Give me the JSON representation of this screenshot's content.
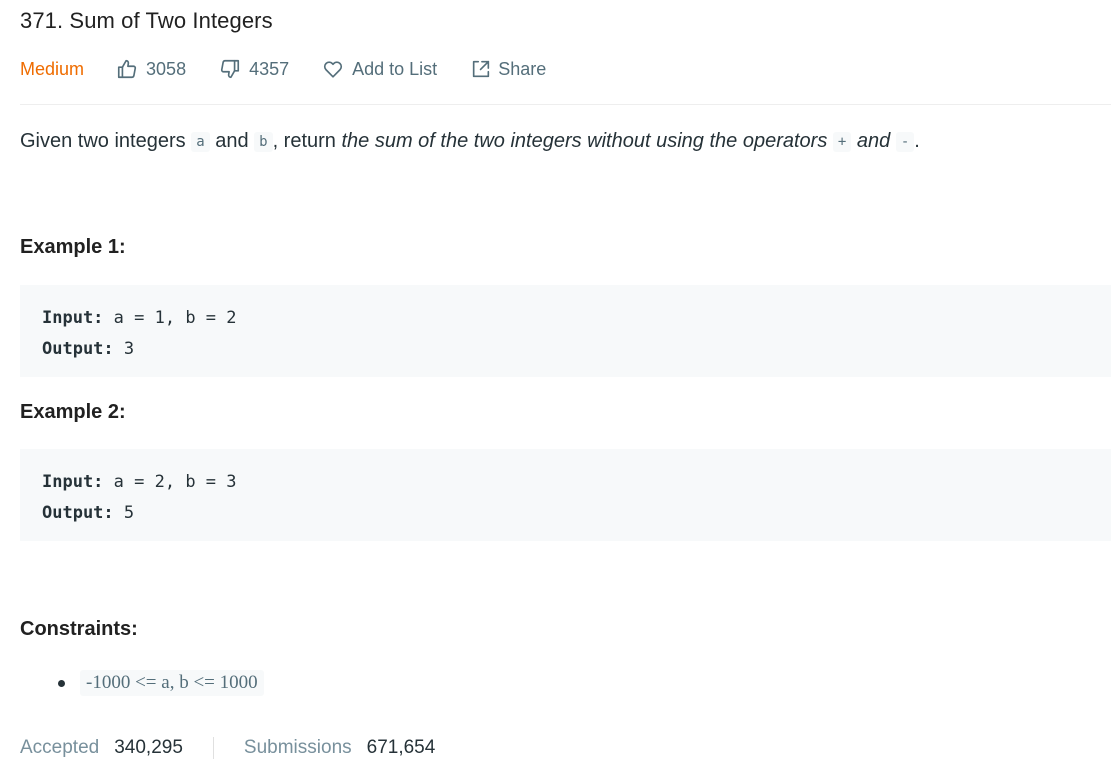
{
  "problem": {
    "title": "371. Sum of Two Integers",
    "difficulty": "Medium",
    "likes": "3058",
    "dislikes": "4357",
    "add_to_list": "Add to List",
    "share": "Share"
  },
  "description": {
    "part1": "Given two integers ",
    "code_a": "a",
    "part2": " and ",
    "code_b": "b",
    "part3": ", return ",
    "italic1": "the sum of the two integers without using the operators",
    "part4": " ",
    "code_plus": "+",
    "part5": " ",
    "italic2": "and",
    "part6": " ",
    "code_minus": "-",
    "part7": "."
  },
  "examples": [
    {
      "heading": "Example 1:",
      "input_label": "Input:",
      "input_value": "a = 1, b = 2",
      "output_label": "Output:",
      "output_value": "3"
    },
    {
      "heading": "Example 2:",
      "input_label": "Input:",
      "input_value": "a = 2, b = 3",
      "output_label": "Output:",
      "output_value": "5"
    }
  ],
  "constraints": {
    "heading": "Constraints:",
    "items": [
      "-1000 <= a, b <= 1000"
    ]
  },
  "stats": {
    "accepted_label": "Accepted",
    "accepted_value": "340,295",
    "submissions_label": "Submissions",
    "submissions_value": "671,654"
  },
  "icons": {
    "like": "thumbs-up-icon",
    "dislike": "thumbs-down-icon",
    "add": "heart-icon",
    "share": "share-icon"
  },
  "colors": {
    "difficulty": "#ef6c00",
    "muted": "#546e7a",
    "code_bg": "#f7f9fa"
  }
}
